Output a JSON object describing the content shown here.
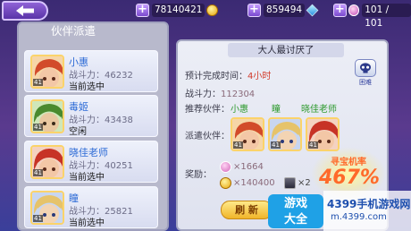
{
  "topbar": {
    "gold": "78140421",
    "diamonds": "859494",
    "energy": "101 / 101"
  },
  "left": {
    "title": "伙伴派遣",
    "cards": [
      {
        "name": "小惠",
        "power": "战斗力：46232",
        "status": "当前选中",
        "level": "41",
        "hair": "#d24b2a",
        "skin": "#f3c7a6"
      },
      {
        "name": "毒姬",
        "power": "战斗力：43438",
        "status": "空闲",
        "level": "41",
        "hair": "#4a8a2e",
        "skin": "#e9c8a0"
      },
      {
        "name": "晓佳老师",
        "power": "战斗力：40251",
        "status": "当前选中",
        "level": "41",
        "hair": "#c73326",
        "skin": "#f3c7a6"
      },
      {
        "name": "瞳",
        "power": "战斗力：25821",
        "status": "当前选中",
        "level": "41",
        "hair": "#e6c36a",
        "skin": "#f3d4b3"
      }
    ]
  },
  "mission": {
    "title": "大人最讨厌了",
    "difficulty": "困难",
    "time_label": "预计完成时间：",
    "time_value": "4小时",
    "power_label": "战斗力：",
    "power_value": "112304",
    "recommend_label": "推荐伙伴：",
    "recommend": [
      "小惠",
      "瞳",
      "晓佳老师"
    ],
    "dispatch_label": "派遣伙伴：",
    "dispatch": [
      {
        "level": "41",
        "hair": "#d24b2a"
      },
      {
        "level": "41",
        "hair": "#e6c36a"
      },
      {
        "level": "41",
        "hair": "#c73326"
      }
    ],
    "reward_label": "奖励：",
    "reward_1": "×1664",
    "reward_2": "×140400",
    "reward_3": "×2",
    "rate_label": "寻宝机率",
    "rate_value": "467%",
    "refresh": "刷 新"
  },
  "watermark": {
    "box": "游戏\n大全",
    "line1": "4399手机游戏网",
    "line2": "m.4399.com"
  }
}
